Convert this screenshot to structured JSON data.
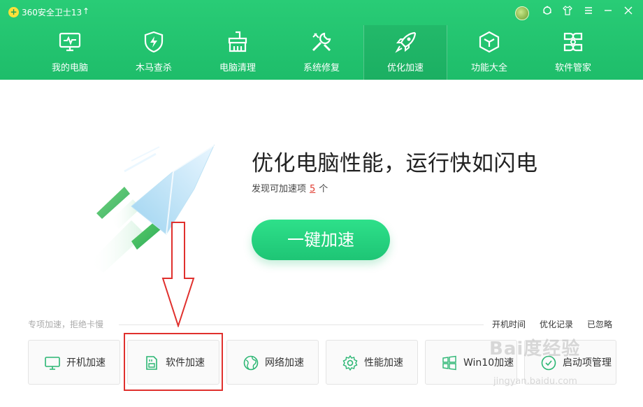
{
  "app": {
    "title": "360安全卫士13"
  },
  "nav": [
    {
      "label": "我的电脑",
      "icon": "monitor-icon"
    },
    {
      "label": "木马查杀",
      "icon": "shield-bolt-icon"
    },
    {
      "label": "电脑清理",
      "icon": "broom-icon"
    },
    {
      "label": "系统修复",
      "icon": "wrench-icon"
    },
    {
      "label": "优化加速",
      "icon": "rocket-icon",
      "active": true
    },
    {
      "label": "功能大全",
      "icon": "cube-icon"
    },
    {
      "label": "软件管家",
      "icon": "grid-clover-icon"
    }
  ],
  "hero": {
    "title": "优化电脑性能，运行快如闪电",
    "sub_prefix": "发现可加速项",
    "count": "5",
    "sub_suffix": "个",
    "button": "一键加速"
  },
  "section": {
    "label": "专项加速，拒绝卡慢",
    "links": [
      "开机时间",
      "优化记录",
      "已忽略"
    ]
  },
  "cards": [
    {
      "label": "开机加速",
      "icon": "monitor-icon"
    },
    {
      "label": "软件加速",
      "icon": "sd-card-icon"
    },
    {
      "label": "网络加速",
      "icon": "globe-icon"
    },
    {
      "label": "性能加速",
      "icon": "gear-icon"
    },
    {
      "label": "Win10加速",
      "icon": "windows-icon"
    },
    {
      "label": "启动项管理",
      "icon": "startup-icon"
    }
  ],
  "watermark": {
    "logo": "Bai度经验",
    "url": "jingyan.baidu.com"
  },
  "colors": {
    "brand": "#1ebd6a",
    "accent_red": "#e03a2e",
    "annotation": "#e0302d"
  }
}
